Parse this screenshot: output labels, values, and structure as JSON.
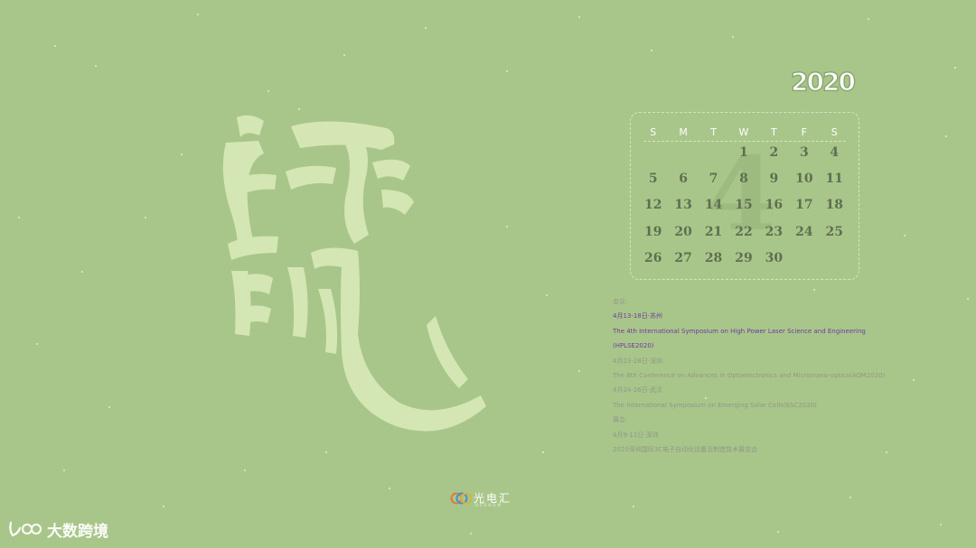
{
  "calendar": {
    "year": "2020",
    "month": "4",
    "weekdays": [
      "S",
      "M",
      "T",
      "W",
      "T",
      "F",
      "S"
    ],
    "weeks": [
      [
        "",
        "",
        "",
        "1",
        "2",
        "3",
        "4"
      ],
      [
        "5",
        "6",
        "7",
        "8",
        "9",
        "10",
        "11"
      ],
      [
        "12",
        "13",
        "14",
        "15",
        "16",
        "17",
        "18"
      ],
      [
        "19",
        "20",
        "21",
        "22",
        "23",
        "24",
        "25"
      ],
      [
        "26",
        "27",
        "28",
        "29",
        "30",
        "",
        ""
      ]
    ]
  },
  "events": [
    {
      "text": "会议:",
      "style": "gray"
    },
    {
      "text": "4月13-18日·苏州",
      "style": "purple"
    },
    {
      "text": "The 4th International Symposium on High Power Laser Science and Engineering",
      "style": "purple"
    },
    {
      "text": "(HPLSE2020)",
      "style": "purple"
    },
    {
      "text": "4月23-28日·深圳",
      "style": "gray"
    },
    {
      "text": "The 8th Conference on Advances in Optoelectronics and Micro/nano-optics(AOM2020)",
      "style": "gray"
    },
    {
      "text": "4月24-26日·武汉",
      "style": "gray"
    },
    {
      "text": "The International Symposium on Emerging Solar Cells(ESC2020)",
      "style": "gray"
    },
    {
      "text": "展会:",
      "style": "gray"
    },
    {
      "text": "4月9-11日·深圳",
      "style": "gray"
    },
    {
      "text": "2020深圳国际3C电子自动化设备及制造技术展览会",
      "style": "gray"
    }
  ],
  "logo": {
    "name_cn": "光电汇",
    "name_en": "OESHOW",
    "trademark": "®"
  },
  "watermark": {
    "text": "大数跨境"
  },
  "colors": {
    "background": "#a9c68a",
    "calligraphy": "#d4e6b4",
    "accent_purple": "#6c3aa0"
  }
}
